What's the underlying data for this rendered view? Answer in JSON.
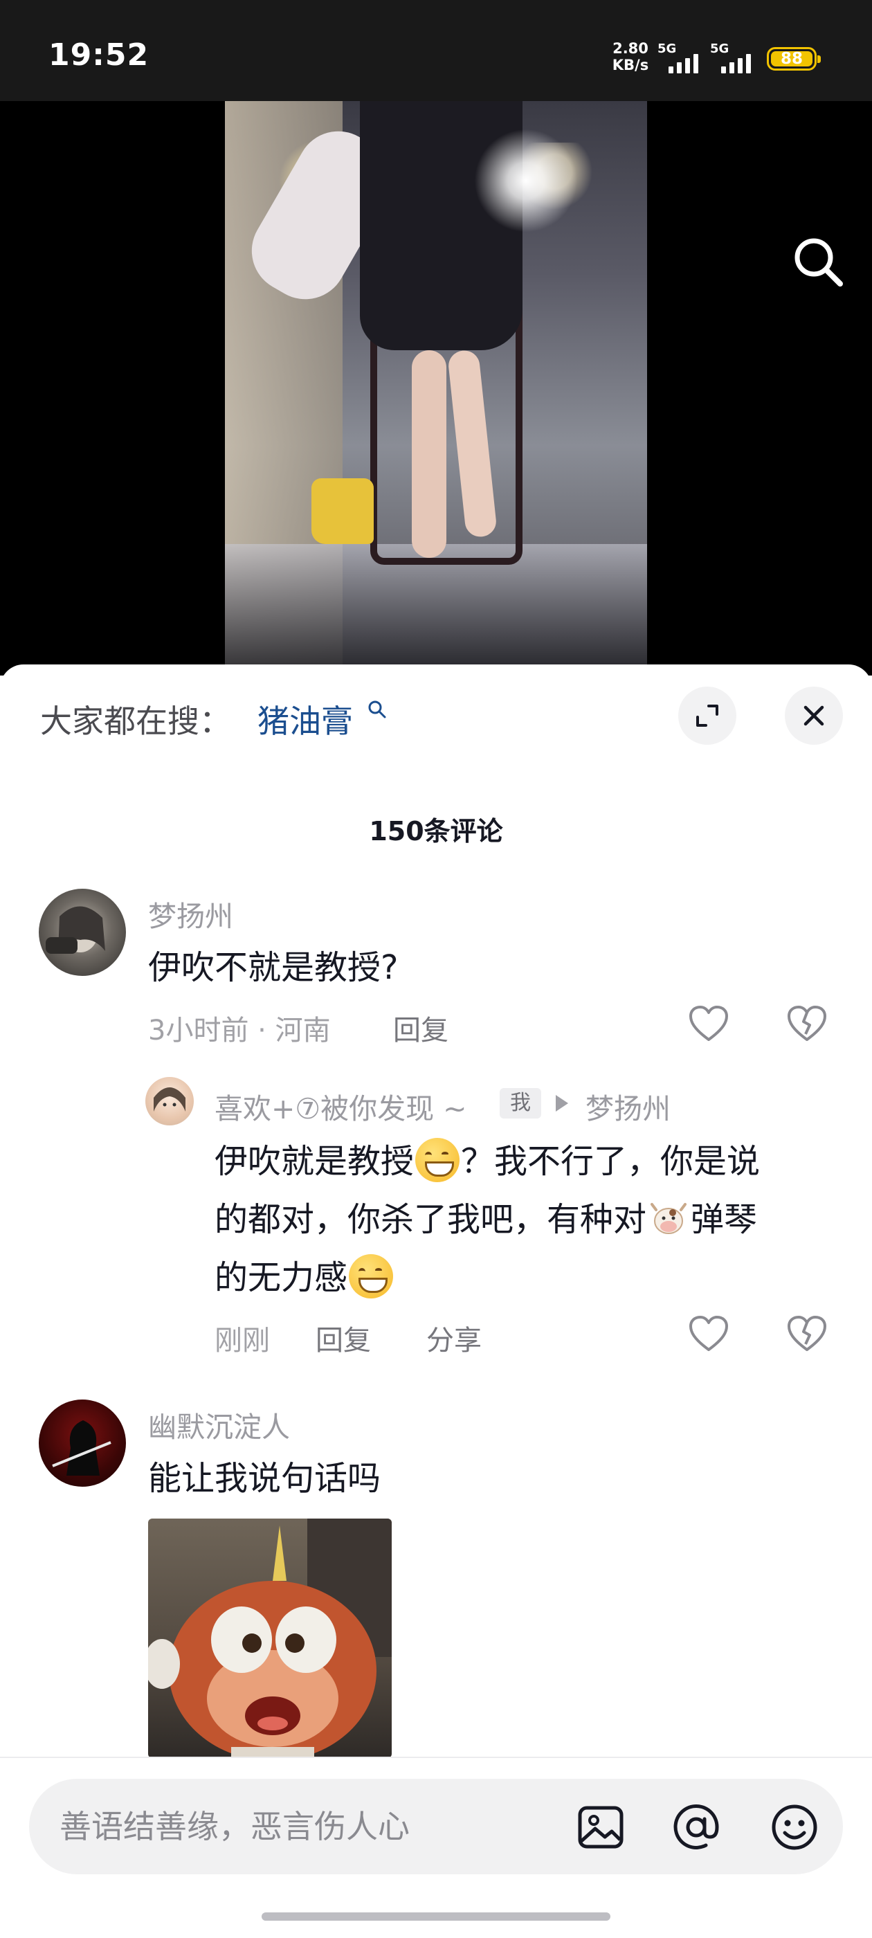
{
  "status_bar": {
    "time": "19:52",
    "net_speed_value": "2.80",
    "net_speed_unit": "KB/s",
    "signal1_label": "5G",
    "signal2_label": "5G",
    "battery": "88"
  },
  "header": {
    "hot_search_prefix": "大家都在搜：",
    "hot_search_term": "猪油膏"
  },
  "comments": {
    "count_label": "150条评论",
    "items": [
      {
        "username": "梦扬州",
        "text": "伊吹不就是教授?",
        "meta": "3小时前 · 河南",
        "reply_label": "回复"
      },
      {
        "username": "幽默沉淀人",
        "text": "能让我说句话吗"
      }
    ],
    "reply": {
      "username": "喜欢+⑦被你发现 ~",
      "tag": "我",
      "reply_to": "梦扬州",
      "line1_a": "伊吹就是教授",
      "line1_b": "？我不行了，你是说",
      "line2_a": "的都对，你杀了我吧，有种对",
      "line2_b": "弹琴",
      "line3": "的无力感",
      "time": "刚刚",
      "reply_label": "回复",
      "share_label": "分享"
    }
  },
  "input": {
    "placeholder": "善语结善缘，恶言伤人心"
  },
  "colors": {
    "link": "#1b4e8f",
    "battery": "#f2c300",
    "text": "#161823",
    "secondary": "#9a9aa0"
  },
  "icons": [
    "search-icon",
    "expand-icon",
    "close-icon",
    "heart-icon",
    "broken-heart-icon",
    "image-icon",
    "at-icon",
    "emoji-icon"
  ]
}
